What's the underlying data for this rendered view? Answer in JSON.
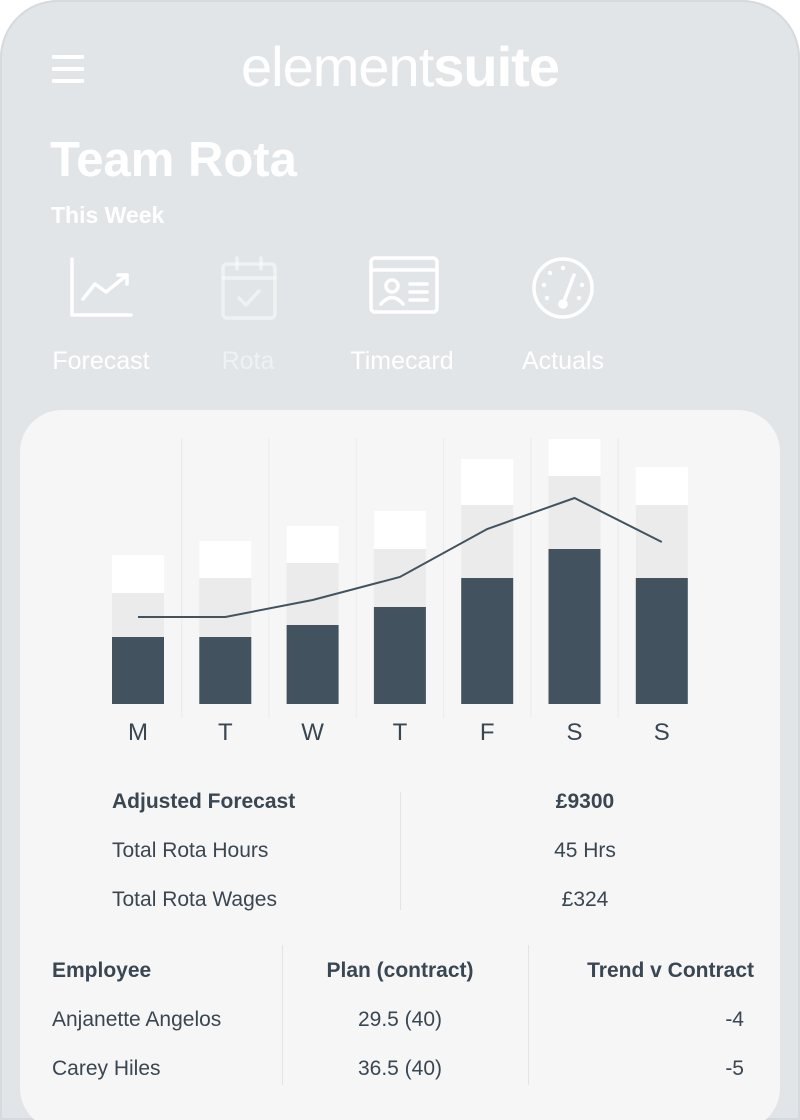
{
  "header": {
    "brand_thin": "element",
    "brand_bold": "suite",
    "title": "Team Rota",
    "subtitle": "This Week"
  },
  "nav": [
    {
      "label": "Forecast",
      "icon": "chart-line-icon",
      "enabled": true
    },
    {
      "label": "Rota",
      "icon": "calendar-check-icon",
      "enabled": false
    },
    {
      "label": "Timecard",
      "icon": "id-card-icon",
      "enabled": true
    },
    {
      "label": "Actuals",
      "icon": "gauge-icon",
      "enabled": true
    }
  ],
  "chart_data": {
    "type": "bar",
    "categories": [
      "M",
      "T",
      "W",
      "T",
      "F",
      "S",
      "S"
    ],
    "series": [
      {
        "values": [
          67,
          67,
          79,
          97,
          126,
          155,
          126
        ]
      },
      {
        "values": [
          44,
          59,
          62,
          58,
          73,
          73,
          73
        ]
      },
      {
        "values": [
          38,
          37,
          37,
          38,
          46,
          37,
          38
        ]
      },
      {
        "values": [
          87,
          87,
          104,
          127,
          175,
          206,
          162
        ]
      }
    ],
    "colors": {
      "base": "#42535f",
      "mid": "#ebebec",
      "top": "#ffffff",
      "line": "#42535f"
    }
  },
  "summary": [
    {
      "label": "Adjusted Forecast",
      "value": "£9300",
      "bold": true
    },
    {
      "label": "Total Rota Hours",
      "value": "45 Hrs",
      "bold": false
    },
    {
      "label": "Total Rota Wages",
      "value": "£324",
      "bold": false
    }
  ],
  "table": {
    "headers": [
      "Employee",
      "Plan (contract)",
      "Trend v Contract"
    ],
    "rows": [
      [
        "Anjanette Angelos",
        "29.5 (40)",
        "-4"
      ],
      [
        "Carey Hiles",
        "36.5 (40)",
        "-5"
      ]
    ]
  },
  "colors": {
    "background": "#e2e5e8",
    "card": "#f6f6f6",
    "text": "#3a4652",
    "accent": "#42535f"
  }
}
